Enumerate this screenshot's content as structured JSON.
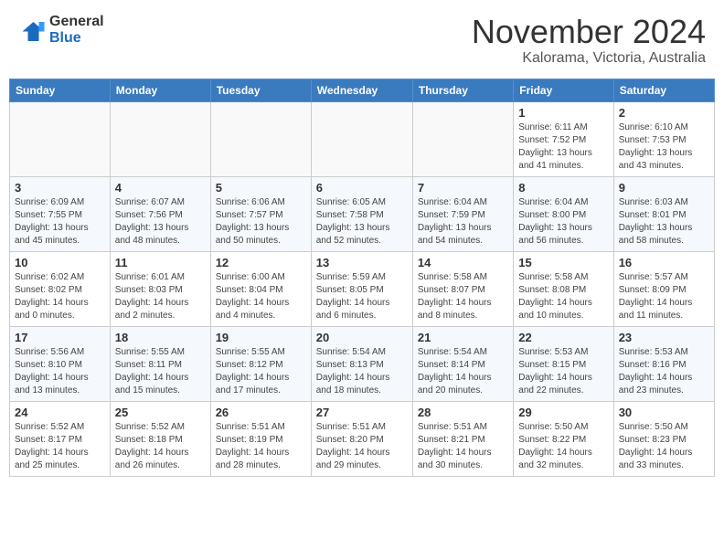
{
  "header": {
    "logo_text_general": "General",
    "logo_text_blue": "Blue",
    "month": "November 2024",
    "location": "Kalorama, Victoria, Australia"
  },
  "weekdays": [
    "Sunday",
    "Monday",
    "Tuesday",
    "Wednesday",
    "Thursday",
    "Friday",
    "Saturday"
  ],
  "weeks": [
    [
      {
        "day": "",
        "info": ""
      },
      {
        "day": "",
        "info": ""
      },
      {
        "day": "",
        "info": ""
      },
      {
        "day": "",
        "info": ""
      },
      {
        "day": "",
        "info": ""
      },
      {
        "day": "1",
        "info": "Sunrise: 6:11 AM\nSunset: 7:52 PM\nDaylight: 13 hours\nand 41 minutes."
      },
      {
        "day": "2",
        "info": "Sunrise: 6:10 AM\nSunset: 7:53 PM\nDaylight: 13 hours\nand 43 minutes."
      }
    ],
    [
      {
        "day": "3",
        "info": "Sunrise: 6:09 AM\nSunset: 7:55 PM\nDaylight: 13 hours\nand 45 minutes."
      },
      {
        "day": "4",
        "info": "Sunrise: 6:07 AM\nSunset: 7:56 PM\nDaylight: 13 hours\nand 48 minutes."
      },
      {
        "day": "5",
        "info": "Sunrise: 6:06 AM\nSunset: 7:57 PM\nDaylight: 13 hours\nand 50 minutes."
      },
      {
        "day": "6",
        "info": "Sunrise: 6:05 AM\nSunset: 7:58 PM\nDaylight: 13 hours\nand 52 minutes."
      },
      {
        "day": "7",
        "info": "Sunrise: 6:04 AM\nSunset: 7:59 PM\nDaylight: 13 hours\nand 54 minutes."
      },
      {
        "day": "8",
        "info": "Sunrise: 6:04 AM\nSunset: 8:00 PM\nDaylight: 13 hours\nand 56 minutes."
      },
      {
        "day": "9",
        "info": "Sunrise: 6:03 AM\nSunset: 8:01 PM\nDaylight: 13 hours\nand 58 minutes."
      }
    ],
    [
      {
        "day": "10",
        "info": "Sunrise: 6:02 AM\nSunset: 8:02 PM\nDaylight: 14 hours\nand 0 minutes."
      },
      {
        "day": "11",
        "info": "Sunrise: 6:01 AM\nSunset: 8:03 PM\nDaylight: 14 hours\nand 2 minutes."
      },
      {
        "day": "12",
        "info": "Sunrise: 6:00 AM\nSunset: 8:04 PM\nDaylight: 14 hours\nand 4 minutes."
      },
      {
        "day": "13",
        "info": "Sunrise: 5:59 AM\nSunset: 8:05 PM\nDaylight: 14 hours\nand 6 minutes."
      },
      {
        "day": "14",
        "info": "Sunrise: 5:58 AM\nSunset: 8:07 PM\nDaylight: 14 hours\nand 8 minutes."
      },
      {
        "day": "15",
        "info": "Sunrise: 5:58 AM\nSunset: 8:08 PM\nDaylight: 14 hours\nand 10 minutes."
      },
      {
        "day": "16",
        "info": "Sunrise: 5:57 AM\nSunset: 8:09 PM\nDaylight: 14 hours\nand 11 minutes."
      }
    ],
    [
      {
        "day": "17",
        "info": "Sunrise: 5:56 AM\nSunset: 8:10 PM\nDaylight: 14 hours\nand 13 minutes."
      },
      {
        "day": "18",
        "info": "Sunrise: 5:55 AM\nSunset: 8:11 PM\nDaylight: 14 hours\nand 15 minutes."
      },
      {
        "day": "19",
        "info": "Sunrise: 5:55 AM\nSunset: 8:12 PM\nDaylight: 14 hours\nand 17 minutes."
      },
      {
        "day": "20",
        "info": "Sunrise: 5:54 AM\nSunset: 8:13 PM\nDaylight: 14 hours\nand 18 minutes."
      },
      {
        "day": "21",
        "info": "Sunrise: 5:54 AM\nSunset: 8:14 PM\nDaylight: 14 hours\nand 20 minutes."
      },
      {
        "day": "22",
        "info": "Sunrise: 5:53 AM\nSunset: 8:15 PM\nDaylight: 14 hours\nand 22 minutes."
      },
      {
        "day": "23",
        "info": "Sunrise: 5:53 AM\nSunset: 8:16 PM\nDaylight: 14 hours\nand 23 minutes."
      }
    ],
    [
      {
        "day": "24",
        "info": "Sunrise: 5:52 AM\nSunset: 8:17 PM\nDaylight: 14 hours\nand 25 minutes."
      },
      {
        "day": "25",
        "info": "Sunrise: 5:52 AM\nSunset: 8:18 PM\nDaylight: 14 hours\nand 26 minutes."
      },
      {
        "day": "26",
        "info": "Sunrise: 5:51 AM\nSunset: 8:19 PM\nDaylight: 14 hours\nand 28 minutes."
      },
      {
        "day": "27",
        "info": "Sunrise: 5:51 AM\nSunset: 8:20 PM\nDaylight: 14 hours\nand 29 minutes."
      },
      {
        "day": "28",
        "info": "Sunrise: 5:51 AM\nSunset: 8:21 PM\nDaylight: 14 hours\nand 30 minutes."
      },
      {
        "day": "29",
        "info": "Sunrise: 5:50 AM\nSunset: 8:22 PM\nDaylight: 14 hours\nand 32 minutes."
      },
      {
        "day": "30",
        "info": "Sunrise: 5:50 AM\nSunset: 8:23 PM\nDaylight: 14 hours\nand 33 minutes."
      }
    ]
  ]
}
